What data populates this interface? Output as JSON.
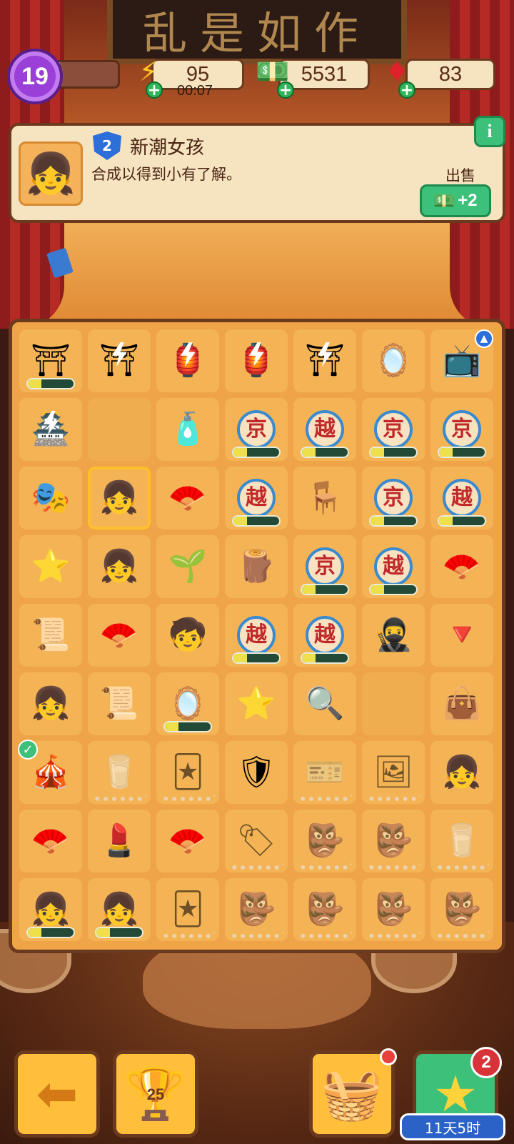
{
  "top_bar": {
    "level": "19",
    "xp_fraction": 0.12,
    "energy": "95",
    "energy_timer": "00:07",
    "cash": "5531",
    "gems": "83"
  },
  "info_panel": {
    "item_level": "2",
    "item_name": "新潮女孩",
    "item_desc": "合成以得到小有了解。",
    "sell_label": "出售",
    "sell_value": "+2",
    "info_icon": "i"
  },
  "board": {
    "cells": [
      {
        "icon": "theater-gate",
        "glyph": "⛩",
        "progress": 0.3
      },
      {
        "icon": "energy-gate",
        "glyph": "⛩",
        "energy": true
      },
      {
        "icon": "energy-stage",
        "glyph": "🏮",
        "energy": true
      },
      {
        "icon": "energy-stage",
        "glyph": "🏮",
        "energy": true
      },
      {
        "icon": "energy-gate",
        "glyph": "⛩",
        "energy": true
      },
      {
        "icon": "mirror",
        "glyph": "🪞"
      },
      {
        "icon": "tv",
        "glyph": "📺",
        "tag": "^"
      },
      {
        "icon": "energy-pavilion",
        "glyph": "🏯",
        "energy": true
      },
      {
        "icon": "empty",
        "glyph": ""
      },
      {
        "icon": "makeup-tray",
        "glyph": "🧴"
      },
      {
        "icon": "jing-stage",
        "glyph": "京",
        "progress": 0.3
      },
      {
        "icon": "yue-stage",
        "glyph": "越",
        "progress": 0.3
      },
      {
        "icon": "jing-stage",
        "glyph": "京",
        "progress": 0.3
      },
      {
        "icon": "jing-stage",
        "glyph": "京",
        "progress": 0.3
      },
      {
        "icon": "opera-mask",
        "glyph": "🎭"
      },
      {
        "icon": "trendy-girl",
        "glyph": "👧",
        "selected": true
      },
      {
        "icon": "folding-fan",
        "glyph": "🪭"
      },
      {
        "icon": "yue-stage",
        "glyph": "越",
        "progress": 0.3
      },
      {
        "icon": "vanity-table",
        "glyph": "🪑"
      },
      {
        "icon": "jing-stage",
        "glyph": "京",
        "progress": 0.3
      },
      {
        "icon": "yue-stage",
        "glyph": "越",
        "progress": 0.3
      },
      {
        "icon": "purple-star",
        "glyph": "⭐"
      },
      {
        "icon": "girl-pigtails",
        "glyph": "👧"
      },
      {
        "icon": "sprout-stump",
        "glyph": "🌱"
      },
      {
        "icon": "green-hair-stump",
        "glyph": "🪵"
      },
      {
        "icon": "jing-stage",
        "glyph": "京",
        "progress": 0.3
      },
      {
        "icon": "yue-stage",
        "glyph": "越",
        "progress": 0.3
      },
      {
        "icon": "painted-fan",
        "glyph": "🪭"
      },
      {
        "icon": "paper-roll",
        "glyph": "📜"
      },
      {
        "icon": "folding-fan",
        "glyph": "🪭"
      },
      {
        "icon": "girl-orange",
        "glyph": "🧒"
      },
      {
        "icon": "yue-stage",
        "glyph": "越",
        "progress": 0.3
      },
      {
        "icon": "yue-stage",
        "glyph": "越",
        "progress": 0.3
      },
      {
        "icon": "opera-warrior",
        "glyph": "🥷"
      },
      {
        "icon": "cone-funnel",
        "glyph": "🔻"
      },
      {
        "icon": "girl-bun",
        "glyph": "👧"
      },
      {
        "icon": "scrolls",
        "glyph": "📜"
      },
      {
        "icon": "gold-mirror",
        "glyph": "🪞",
        "progress": 0.3
      },
      {
        "icon": "smiling-purple-star",
        "glyph": "⭐"
      },
      {
        "icon": "hand-mirror",
        "glyph": "🔍"
      },
      {
        "icon": "empty",
        "glyph": ""
      },
      {
        "icon": "purple-bag",
        "glyph": "👜"
      },
      {
        "icon": "red-curtain",
        "glyph": "🎪",
        "check": true
      },
      {
        "icon": "frozen-cup",
        "glyph": "🥛",
        "frozen": true
      },
      {
        "icon": "frozen-mask-card",
        "glyph": "🃏",
        "frozen": true
      },
      {
        "icon": "sparkle-shield",
        "glyph": "🛡"
      },
      {
        "icon": "frozen-ticket",
        "glyph": "🎫",
        "frozen": true
      },
      {
        "icon": "frozen-mask-frame",
        "glyph": "🖼",
        "frozen": true
      },
      {
        "icon": "girl-green",
        "glyph": "👧"
      },
      {
        "icon": "painted-fan",
        "glyph": "🪭"
      },
      {
        "icon": "makeup-vanity",
        "glyph": "💄"
      },
      {
        "icon": "painted-fan",
        "glyph": "🪭"
      },
      {
        "icon": "frozen-tag",
        "glyph": "🏷",
        "frozen": true
      },
      {
        "icon": "frozen-mask-chest",
        "glyph": "👺",
        "frozen": true
      },
      {
        "icon": "frozen-mask-chest",
        "glyph": "👺",
        "frozen": true
      },
      {
        "icon": "frozen-cup",
        "glyph": "🥛",
        "frozen": true
      },
      {
        "icon": "twin-bun-girl",
        "glyph": "👧",
        "progress": 0.3
      },
      {
        "icon": "twin-bun-girl",
        "glyph": "👧",
        "progress": 0.3
      },
      {
        "icon": "frozen-mask-card",
        "glyph": "🃏",
        "frozen": true
      },
      {
        "icon": "frozen-mask-chest",
        "glyph": "👺",
        "frozen": true
      },
      {
        "icon": "frozen-mask-chest",
        "glyph": "👺",
        "frozen": true
      },
      {
        "icon": "frozen-mask-chest",
        "glyph": "👺",
        "frozen": true
      },
      {
        "icon": "frozen-mask-chest",
        "glyph": "👺",
        "frozen": true
      }
    ]
  },
  "toolbar": {
    "back_icon": "⬅",
    "trophy_icon": "🏆",
    "trophy_count": "25",
    "basket_icon": "🧺",
    "star_icon": "★",
    "star_badge": "2",
    "event_timer": "11天5时"
  },
  "colors": {
    "accent_green": "#3dc07a",
    "board": "#eea447",
    "frame": "#6b3a1e"
  }
}
